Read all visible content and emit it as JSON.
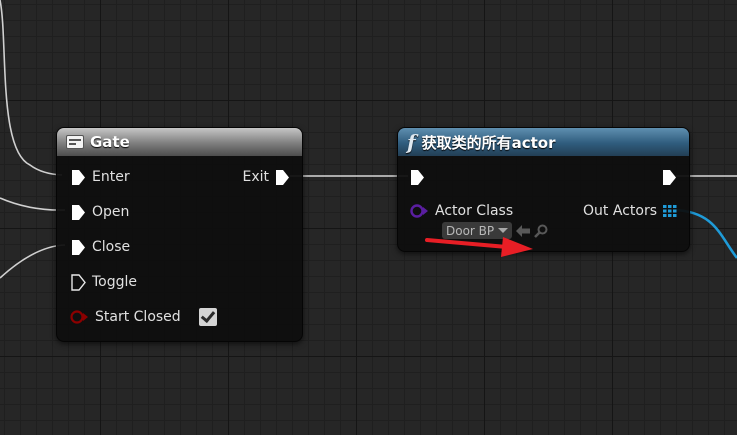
{
  "gate_node": {
    "title": "Gate",
    "inputs": [
      {
        "label": "Enter"
      },
      {
        "label": "Open"
      },
      {
        "label": "Close"
      },
      {
        "label": "Toggle"
      },
      {
        "label": "Start Closed",
        "checked": true
      }
    ],
    "output": {
      "label": "Exit"
    }
  },
  "getall_node": {
    "title": "获取类的所有actor",
    "actor_class_label": "Actor Class",
    "actor_class_value": "Door BP",
    "out_label": "Out Actors"
  },
  "colors": {
    "exec_pin": "#ffffff",
    "bool_pin": "#8c0000",
    "class_pin": "#5a1ea0",
    "object_array_pin": "#1f9bd8",
    "object_wire": "#1f9bd8",
    "exec_wire": "#d8d8d8",
    "annotation_arrow": "#e81e25"
  },
  "icons": {
    "gate_header": "gate-macro-icon",
    "function_header": "function-f-icon",
    "use_selected": "arrow-left-icon",
    "browse": "magnifier-icon",
    "array_pin": "grid-array-icon"
  }
}
